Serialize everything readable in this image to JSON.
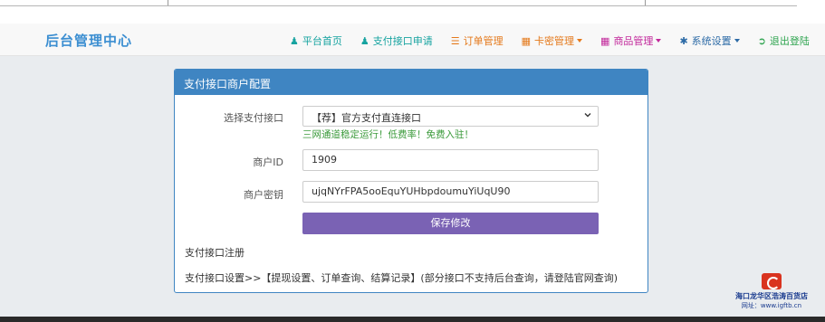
{
  "brand": "后台管理中心",
  "nav": {
    "home": "平台首页",
    "pay_apply": "支付接口申请",
    "orders": "订单管理",
    "cards": "卡密管理",
    "products": "商品管理",
    "system": "系统设置",
    "logout": "退出登陆"
  },
  "panel": {
    "title": "支付接口商户配置",
    "select_label": "选择支付接口",
    "select_value": "【荐】官方支付直连接口",
    "hint": "三网通道稳定运行！低费率！免费入驻！",
    "merchant_id_label": "商户ID",
    "merchant_id_value": "1909",
    "merchant_key_label": "商户密钥",
    "merchant_key_value": "ujqNYrFPA5ooEquYUHbpdoumuYiUqU90",
    "save_button": "保存修改",
    "register_link": "支付接口注册",
    "settings_line": "支付接口设置>>【提现设置、订单查询、结算记录】(部分接口不支持后台查询，请登陆官网查询)"
  },
  "watermark": {
    "name": "海口龙华区浩涛百货店",
    "url": "网址：www.igftb.cn"
  }
}
